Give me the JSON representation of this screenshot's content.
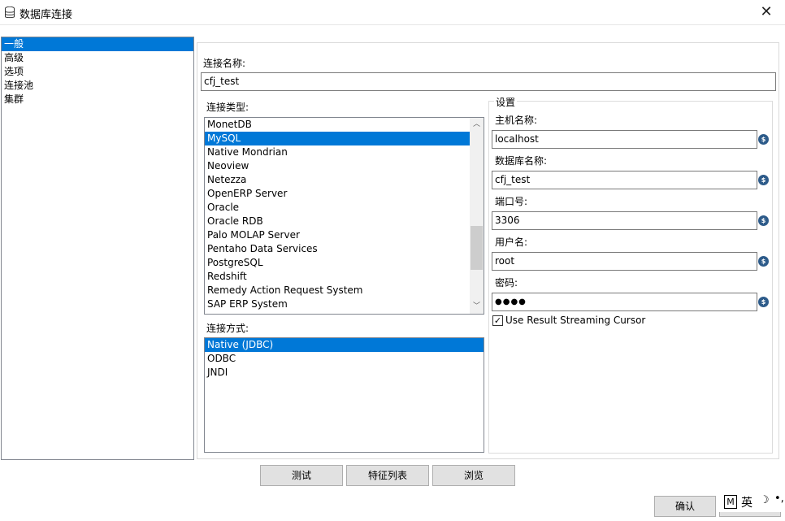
{
  "window": {
    "title": "数据库连接",
    "icon": "database-icon",
    "close_glyph": "✕"
  },
  "categories": [
    {
      "label": "一般",
      "selected": true
    },
    {
      "label": "高级",
      "selected": false
    },
    {
      "label": "选项",
      "selected": false
    },
    {
      "label": "连接池",
      "selected": false
    },
    {
      "label": "集群",
      "selected": false
    }
  ],
  "connection_name": {
    "label": "连接名称:",
    "value": "cfj_test"
  },
  "connection_type": {
    "label": "连接类型:",
    "items": [
      "MonetDB",
      "MySQL",
      "Native Mondrian",
      "Neoview",
      "Netezza",
      "OpenERP Server",
      "Oracle",
      "Oracle RDB",
      "Palo MOLAP Server",
      "Pentaho Data Services",
      "PostgreSQL",
      "Redshift",
      "Remedy Action Request System",
      "SAP ERP System"
    ],
    "selected": "MySQL"
  },
  "access_method": {
    "label": "连接方式:",
    "items": [
      "Native (JDBC)",
      "ODBC",
      "JNDI"
    ],
    "selected": "Native (JDBC)"
  },
  "settings": {
    "title": "设置",
    "host_label": "主机名称:",
    "host_value": "localhost",
    "db_label": "数据库名称:",
    "db_value": "cfj_test",
    "port_label": "端口号:",
    "port_value": "3306",
    "user_label": "用户名:",
    "user_value": "root",
    "password_label": "密码:",
    "password_value": "●●●●",
    "variable_icon": "$",
    "streaming_label": "Use Result Streaming Cursor",
    "streaming_checked": true,
    "check_glyph": "✓"
  },
  "buttons": {
    "test": "测试",
    "features": "特征列表",
    "explore": "浏览",
    "ok": "确认"
  },
  "ime": {
    "mode": "M",
    "lang": "英",
    "moon": "☽",
    "dots": "•,"
  },
  "colors": {
    "selection": "#0078d7",
    "variable_icon": "#2d5b8a"
  }
}
